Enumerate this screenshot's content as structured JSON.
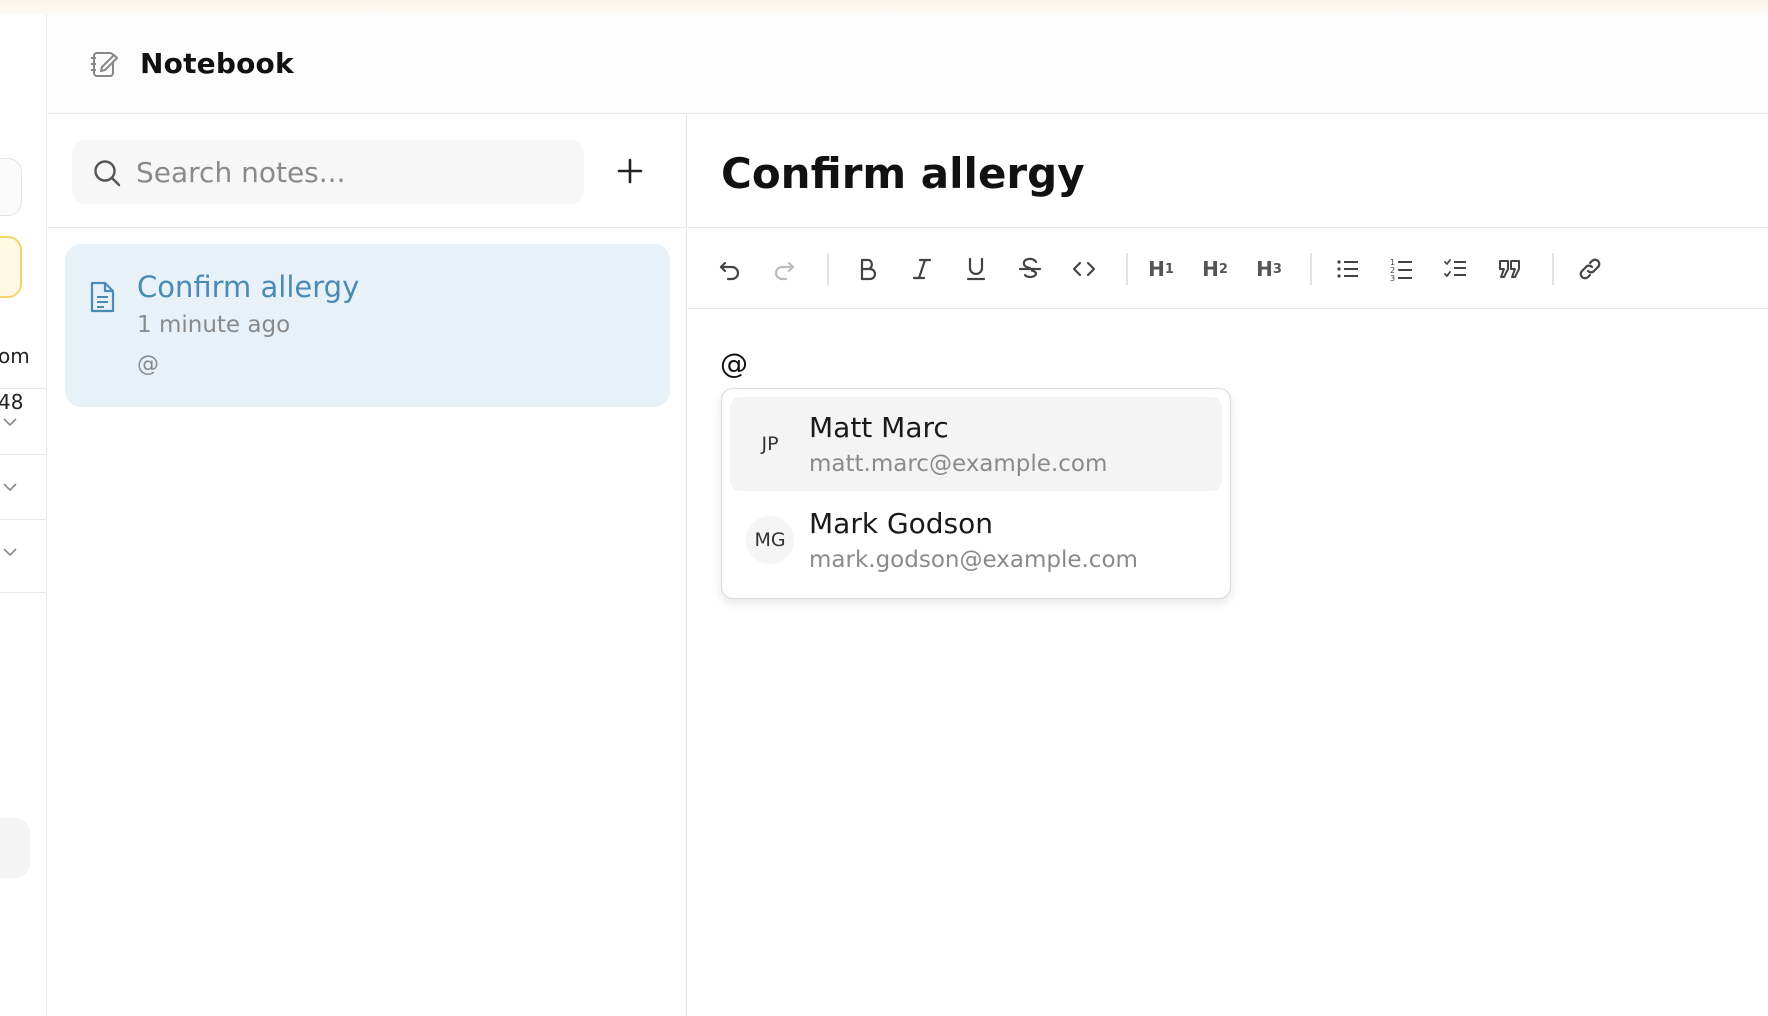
{
  "app": {
    "title": "Notebook"
  },
  "left_sidebar": {
    "partial_texts": [
      "om",
      "48"
    ]
  },
  "search": {
    "placeholder": "Search notes...",
    "value": ""
  },
  "notes": [
    {
      "title": "Confirm allergy",
      "time": "1 minute ago",
      "preview": "@"
    }
  ],
  "editor": {
    "title": "Confirm allergy",
    "content": "@",
    "toolbar": {
      "h1": "H",
      "h2": "H",
      "h3": "H",
      "h1_sub": "1",
      "h2_sub": "2",
      "h3_sub": "3"
    }
  },
  "mention_popup": {
    "items": [
      {
        "initials": "JP",
        "name": "Matt Marc",
        "email": "matt.marc@example.com",
        "highlighted": true
      },
      {
        "initials": "MG",
        "name": "Mark Godson",
        "email": "mark.godson@example.com",
        "highlighted": false
      }
    ]
  },
  "colors": {
    "accent": "#4a8bb5",
    "selected_note_bg": "#e8f1f8",
    "highlight_bg": "#f4f4f4"
  }
}
